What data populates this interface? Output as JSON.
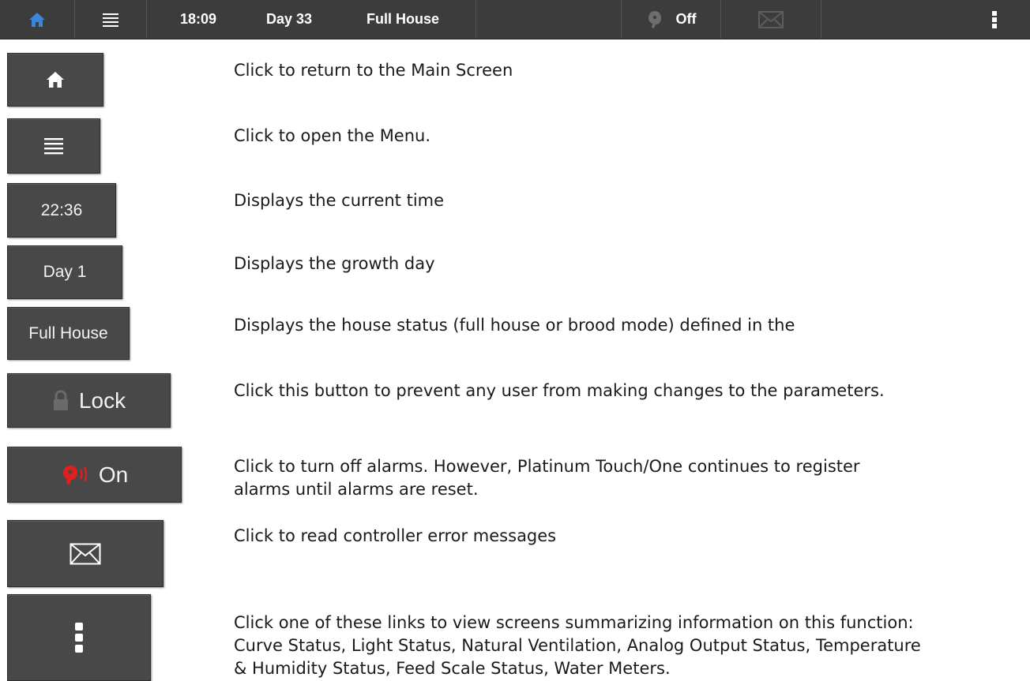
{
  "topbar": {
    "time": "18:09",
    "day": "Day 33",
    "house_status": "Full House",
    "alarm_state": "Off"
  },
  "legend": [
    {
      "button_icon": "home-icon",
      "button_label": "",
      "description": [
        "Click to return to the Main Screen"
      ]
    },
    {
      "button_icon": "menu-icon",
      "button_label": "",
      "description": [
        "Click to open the Menu."
      ]
    },
    {
      "button_icon": "",
      "button_label": "22:36",
      "description": [
        "Displays the current time"
      ]
    },
    {
      "button_icon": "",
      "button_label": "Day 1",
      "description": [
        "Displays the growth day"
      ]
    },
    {
      "button_icon": "",
      "button_label": "Full House",
      "description": [
        "Displays the house status (full house or brood mode) defined in the"
      ]
    },
    {
      "button_icon": "lock-icon",
      "button_label": "Lock",
      "description": [
        "Click this button to prevent any user from making changes to the parameters."
      ]
    },
    {
      "button_icon": "alarm-siren-icon",
      "button_label": "On",
      "description": [
        "Click to turn off alarms. However, Platinum Touch/One continues to register",
        "alarms until alarms are reset."
      ]
    },
    {
      "button_icon": "envelope-icon",
      "button_label": "",
      "description": [
        "Click to read controller error messages"
      ]
    },
    {
      "button_icon": "kebab-menu-icon",
      "button_label": "",
      "description": [
        "Click one of these links to view screens summarizing information on this function:",
        "Curve Status, Light Status, Natural Ventilation, Analog Output Status, Temperature",
        "& Humidity Status, Feed Scale Status, Water Meters."
      ]
    }
  ],
  "colors": {
    "home_accent": "#3a86d8",
    "bar_background": "#3c3c3c",
    "button_background": "#484848",
    "alarm_red": "#e02020"
  }
}
